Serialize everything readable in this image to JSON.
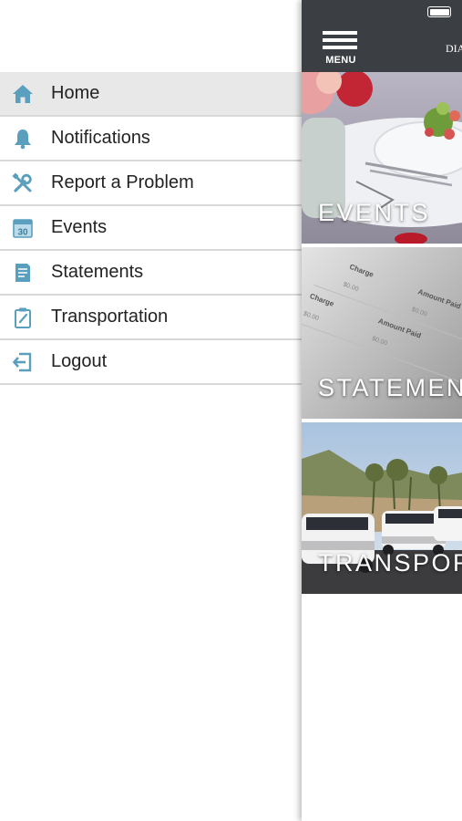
{
  "menu": {
    "items": [
      {
        "label": "Home",
        "icon": "home-icon",
        "active": true
      },
      {
        "label": "Notifications",
        "icon": "bell-icon",
        "active": false
      },
      {
        "label": "Report a Problem",
        "icon": "tools-icon",
        "active": false
      },
      {
        "label": "Events",
        "icon": "calendar-icon",
        "active": false
      },
      {
        "label": "Statements",
        "icon": "document-icon",
        "active": false
      },
      {
        "label": "Transportation",
        "icon": "clipboard-icon",
        "active": false
      },
      {
        "label": "Logout",
        "icon": "logout-icon",
        "active": false
      }
    ],
    "calendar_day": "30"
  },
  "topbar": {
    "menu_label": "MENU",
    "brand_text": "DIA"
  },
  "tiles": [
    {
      "label": "EVENTS"
    },
    {
      "label": "STATEMENTS"
    },
    {
      "label": "TRANSPORTATION"
    }
  ],
  "statement_image_text": {
    "charge": "Charge",
    "amount_paid": "Amount Paid",
    "amount": "$0.00"
  },
  "colors": {
    "icon_accent": "#5a9fbd",
    "topbar_bg": "#3b3f43",
    "active_row_bg": "#e8e8e8",
    "divider": "#d9d9d9"
  }
}
